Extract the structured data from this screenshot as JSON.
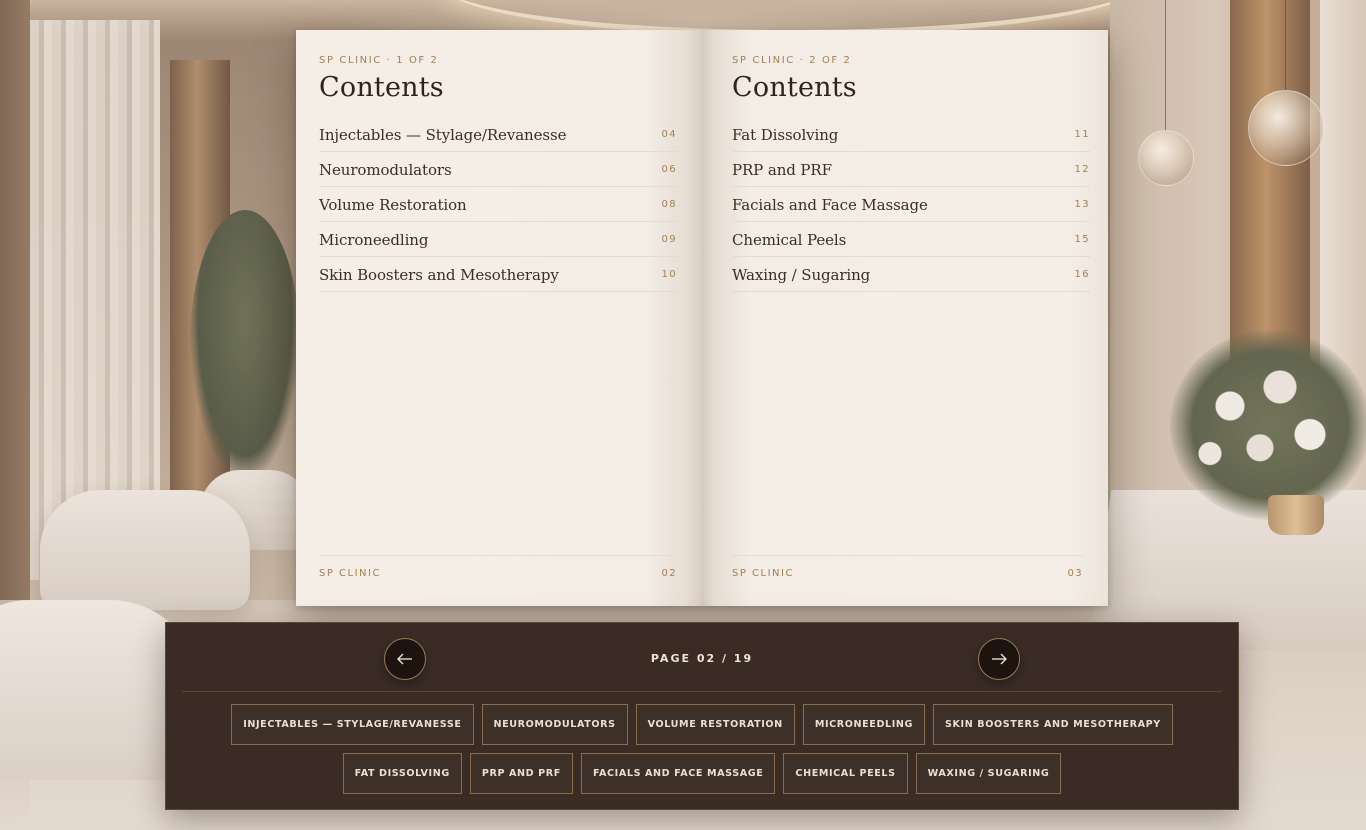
{
  "book": {
    "left_page": {
      "kicker": "SP CLINIC · 1 OF 2",
      "title": "Contents",
      "items": [
        {
          "title": "Injectables — Stylage/Revanesse",
          "page": "04"
        },
        {
          "title": "Neuromodulators",
          "page": "06"
        },
        {
          "title": "Volume Restoration",
          "page": "08"
        },
        {
          "title": "Microneedling",
          "page": "09"
        },
        {
          "title": "Skin Boosters and Mesotherapy",
          "page": "10"
        }
      ],
      "footer_brand": "SP CLINIC",
      "footer_number": "02"
    },
    "right_page": {
      "kicker": "SP CLINIC · 2 OF 2",
      "title": "Contents",
      "items": [
        {
          "title": "Fat Dissolving",
          "page": "11"
        },
        {
          "title": "PRP and PRF",
          "page": "12"
        },
        {
          "title": "Facials and Face Massage",
          "page": "13"
        },
        {
          "title": "Chemical Peels",
          "page": "15"
        },
        {
          "title": "Waxing / Sugaring",
          "page": "16"
        }
      ],
      "footer_brand": "SP CLINIC",
      "footer_number": "03"
    }
  },
  "controls": {
    "page_indicator": "PAGE 02 / 19",
    "prev_icon": "arrow-left-icon",
    "next_icon": "arrow-right-icon",
    "chips": [
      "INJECTABLES — STYLAGE/REVANESSE",
      "NEUROMODULATORS",
      "VOLUME RESTORATION",
      "MICRONEEDLING",
      "SKIN BOOSTERS AND MESOTHERAPY",
      "FAT DISSOLVING",
      "PRP AND PRF",
      "FACIALS AND FACE MASSAGE",
      "CHEMICAL PEELS",
      "WAXING / SUGARING"
    ]
  },
  "colors": {
    "accent_gold": "#a47f52",
    "panel_dark": "#3a2c25",
    "page_paper": "#f4eee7",
    "ink": "#2f241c"
  }
}
